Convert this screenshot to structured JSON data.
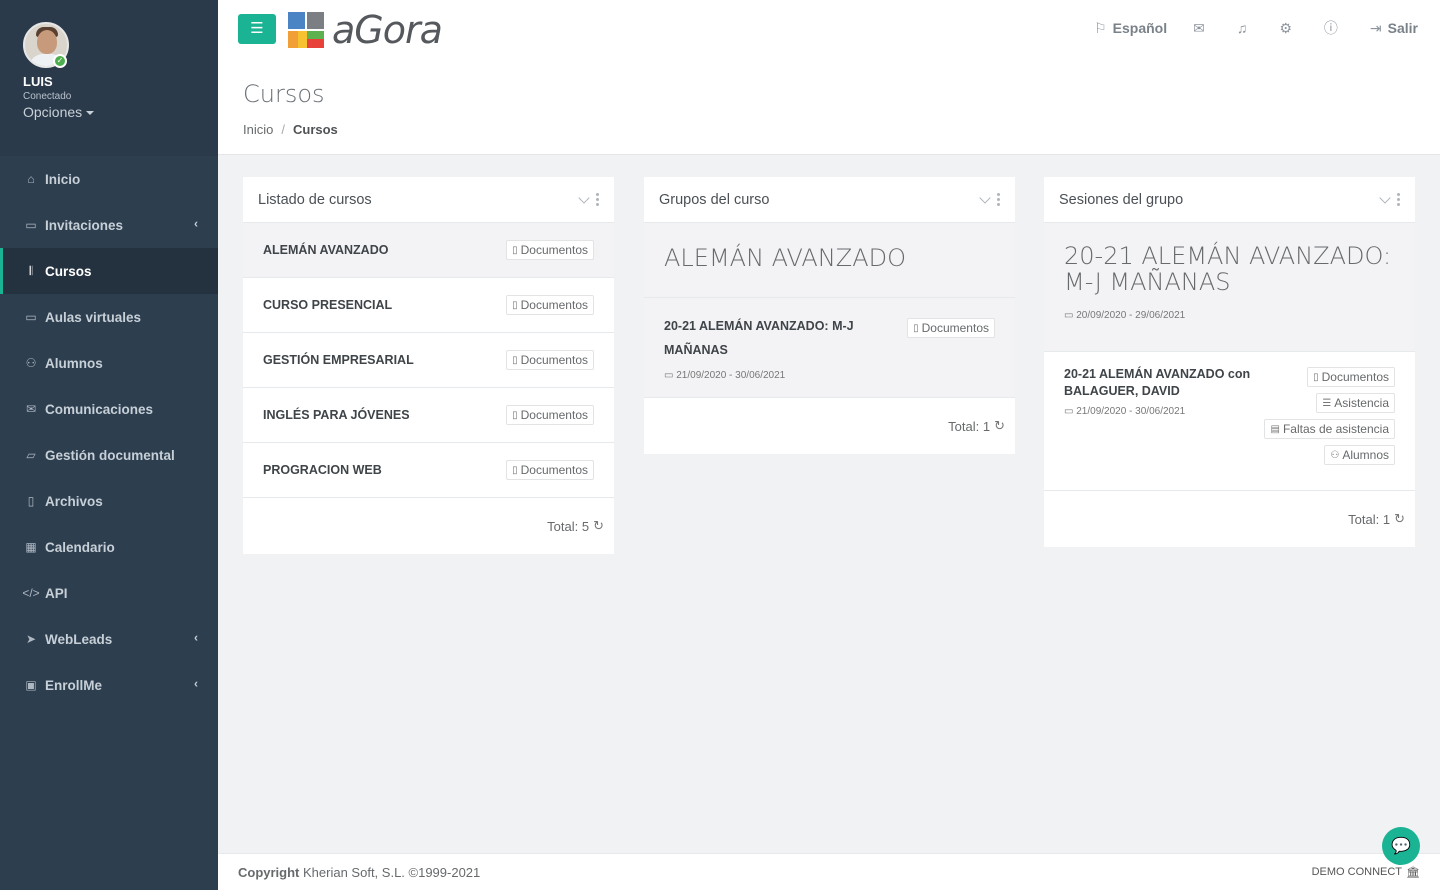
{
  "user": {
    "name": "LUIS",
    "status": "Conectado",
    "options": "Opciones"
  },
  "nav": [
    {
      "label": "Inicio",
      "icon": "home-icon",
      "glyph": "⌂",
      "arrow": false
    },
    {
      "label": "Invitaciones",
      "icon": "card-icon",
      "glyph": "▭",
      "arrow": true
    },
    {
      "label": "Cursos",
      "icon": "books-icon",
      "glyph": "𝄃",
      "arrow": false,
      "active": true
    },
    {
      "label": "Aulas virtuales",
      "icon": "laptop-icon",
      "glyph": "▭",
      "arrow": false
    },
    {
      "label": "Alumnos",
      "icon": "users-icon",
      "glyph": "⚇",
      "arrow": false
    },
    {
      "label": "Comunicaciones",
      "icon": "envelope-icon",
      "glyph": "✉",
      "arrow": false
    },
    {
      "label": "Gestión documental",
      "icon": "folder-icon",
      "glyph": "▱",
      "arrow": false
    },
    {
      "label": "Archivos",
      "icon": "file-icon",
      "glyph": "▯",
      "arrow": false
    },
    {
      "label": "Calendario",
      "icon": "calendar-icon",
      "glyph": "▦",
      "arrow": false
    },
    {
      "label": "API",
      "icon": "code-icon",
      "glyph": "</>",
      "arrow": false
    },
    {
      "label": "WebLeads",
      "icon": "paper-plane-icon",
      "glyph": "➤",
      "arrow": true
    },
    {
      "label": "EnrollMe",
      "icon": "id-card-icon",
      "glyph": "▣",
      "arrow": true
    }
  ],
  "brand": {
    "name": "aGora"
  },
  "topnav": {
    "language": "Español",
    "logout": "Salir"
  },
  "page": {
    "title": "Cursos",
    "breadcrumb_home": "Inicio",
    "breadcrumb_current": "Cursos"
  },
  "panels": {
    "courses": {
      "title": "Listado de cursos",
      "items": [
        {
          "name": "ALEMÁN AVANZADO",
          "button": "Documentos"
        },
        {
          "name": "CURSO PRESENCIAL",
          "button": "Documentos"
        },
        {
          "name": "GESTIÓN EMPRESARIAL",
          "button": "Documentos"
        },
        {
          "name": "INGLÉS PARA JÓVENES",
          "button": "Documentos"
        },
        {
          "name": "PROGRACION WEB",
          "button": "Documentos"
        }
      ],
      "total": "Total: 5"
    },
    "groups": {
      "title": "Grupos del curso",
      "heading": "ALEMÁN AVANZADO",
      "item": {
        "name": "20-21 ALEMÁN AVANZADO: M-J MAÑANAS",
        "dates": "21/09/2020 - 30/06/2021",
        "button": "Documentos"
      },
      "total": "Total: 1"
    },
    "sessions": {
      "title": "Sesiones del grupo",
      "heading": "20-21 ALEMÁN AVANZADO: M-J MAÑANAS",
      "heading_dates": "20/09/2020 - 29/06/2021",
      "item": {
        "name": "20-21 ALEMÁN AVANZADO con BALAGUER, DAVID",
        "dates": "21/09/2020 - 30/06/2021",
        "buttons": [
          "Documentos",
          "Asistencia",
          "Faltas de asistencia",
          "Alumnos"
        ]
      },
      "total": "Total: 1"
    }
  },
  "footer": {
    "copyright_bold": "Copyright",
    "copyright_rest": "Kherian Soft, S.L. ©1999-2021",
    "right": "DEMO CONNECT"
  },
  "colors": {
    "accent": "#1ab394",
    "sidebar": "#2d3e4f"
  }
}
